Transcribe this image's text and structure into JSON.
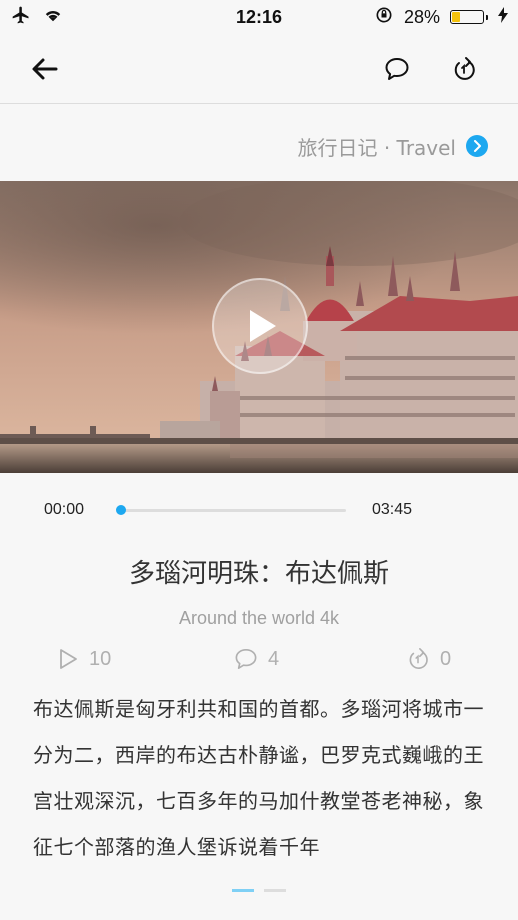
{
  "status_bar": {
    "time": "12:16",
    "battery_percent": "28%",
    "battery_level": 0.28,
    "icons": [
      "airplane-icon",
      "wifi-icon",
      "rotation-lock-icon",
      "battery-icon",
      "charging-bolt-icon"
    ]
  },
  "nav": {
    "icons": [
      "back-arrow-icon",
      "comment-icon",
      "share-icon"
    ]
  },
  "category": {
    "label": "旅行日记 · Travel",
    "icon": "chevron-right-icon",
    "accent": "#1da8f0"
  },
  "video": {
    "image_desc_icon": "play-icon",
    "current_time": "00:00",
    "total_time": "03:45",
    "progress": 0
  },
  "article": {
    "title": "多瑙河明珠：布达佩斯",
    "subtitle": "Around the world 4k",
    "description": "布达佩斯是匈牙利共和国的首都。多瑙河将城市一分为二，西岸的布达古朴静谧，巴罗克式巍峨的王宫壮观深沉，七百多年的马加什教堂苍老神秘，象征七个部落的渔人堡诉说着千年"
  },
  "stats": {
    "plays": "10",
    "comments": "4",
    "shares": "0"
  },
  "pager": {
    "pages": 2,
    "active": 1
  }
}
